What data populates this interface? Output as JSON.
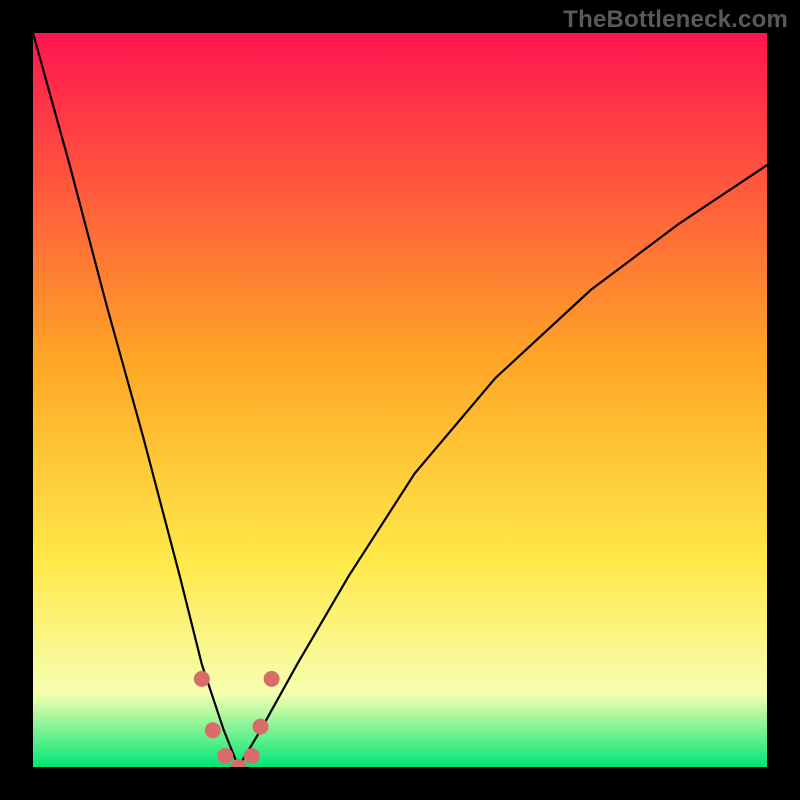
{
  "watermark": {
    "text": "TheBottleneck.com"
  },
  "colors": {
    "gradient_top": "#ff1450",
    "gradient_upper_mid": "#ffa726",
    "gradient_mid": "#ffe94a",
    "gradient_lower": "#f6ffb0",
    "gradient_bottom": "#00e676",
    "curve_stroke": "#000000",
    "markers": "#d96b6b",
    "frame_bg": "#000000",
    "watermark_color": "#58595b"
  },
  "chart_data": {
    "type": "line",
    "title": "",
    "xlabel": "",
    "ylabel": "",
    "xlim": [
      0,
      1
    ],
    "ylim": [
      0,
      100
    ],
    "legend": false,
    "grid": false,
    "notes": "Two curves share a common minimum near x≈0.28 y≈0 then diverge upward. Left branch is steep, right branch is gentler. Small marker cluster at the valley.",
    "series": [
      {
        "name": "left_branch",
        "x": [
          0.0,
          0.05,
          0.1,
          0.15,
          0.2,
          0.23,
          0.26,
          0.28
        ],
        "y": [
          100.0,
          82.0,
          63.0,
          45.0,
          26.0,
          14.0,
          5.0,
          0.0
        ]
      },
      {
        "name": "right_branch",
        "x": [
          0.28,
          0.31,
          0.36,
          0.43,
          0.52,
          0.63,
          0.76,
          0.88,
          1.0
        ],
        "y": [
          0.0,
          5.0,
          14.0,
          26.0,
          40.0,
          53.0,
          65.0,
          74.0,
          82.0
        ]
      }
    ],
    "markers": {
      "name": "valley_points",
      "points": [
        {
          "x": 0.23,
          "y": 12.0
        },
        {
          "x": 0.245,
          "y": 5.0
        },
        {
          "x": 0.262,
          "y": 1.5
        },
        {
          "x": 0.28,
          "y": 0.0
        },
        {
          "x": 0.298,
          "y": 1.5
        },
        {
          "x": 0.31,
          "y": 5.5
        },
        {
          "x": 0.325,
          "y": 12.0
        }
      ]
    }
  }
}
